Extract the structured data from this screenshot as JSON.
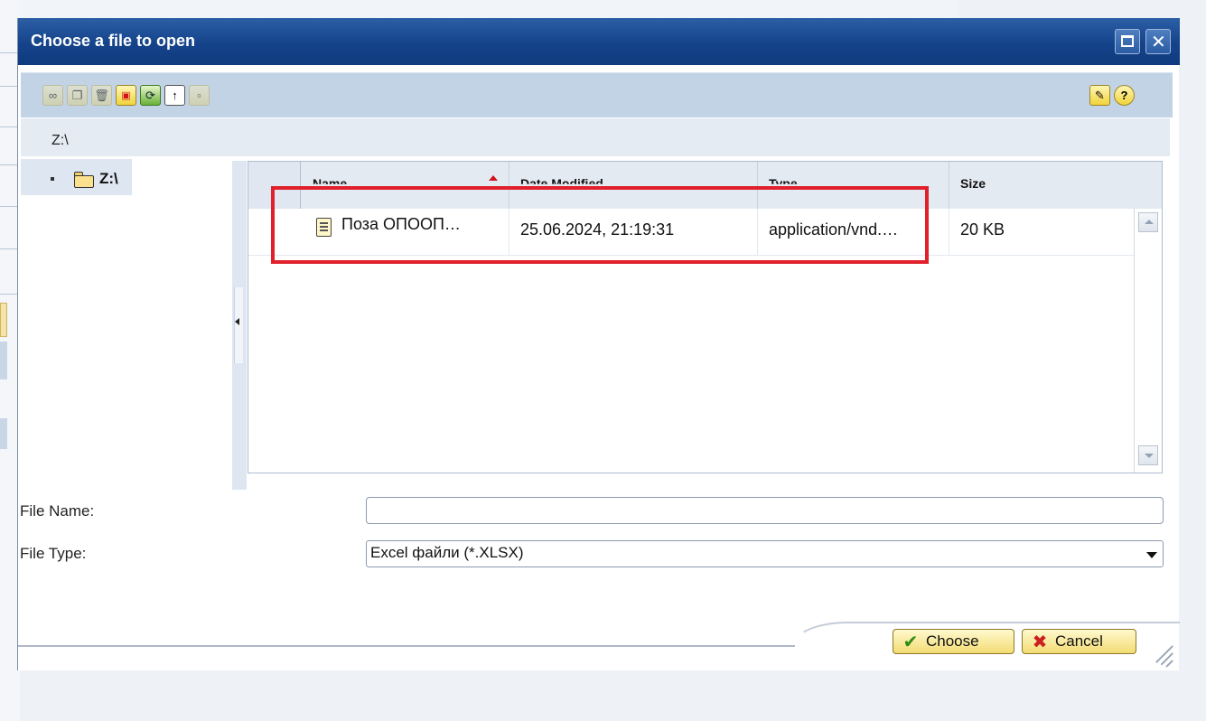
{
  "dialog": {
    "title": "Choose a file to open",
    "path": "Z:\\"
  },
  "toolbar": {
    "buttons": [
      {
        "icon": "link-icon",
        "enabled": false
      },
      {
        "icon": "copy-icon",
        "enabled": false
      },
      {
        "icon": "delete-icon",
        "enabled": false
      },
      {
        "icon": "new-folder-icon",
        "enabled": true
      },
      {
        "icon": "refresh-icon",
        "enabled": true
      },
      {
        "icon": "up-folder-icon",
        "enabled": true
      },
      {
        "icon": "view-icon",
        "enabled": false
      }
    ],
    "right_buttons": [
      {
        "icon": "pencil-icon"
      },
      {
        "icon": "help-icon"
      }
    ]
  },
  "tree": {
    "items": [
      {
        "label": "Z:\\",
        "icon": "folder-icon"
      }
    ]
  },
  "table": {
    "columns": [
      "Name",
      "Date Modified",
      "Type",
      "Size"
    ],
    "sort_column": "Name",
    "rows": [
      {
        "name": "Поза ОПООП…",
        "date_modified": "25.06.2024, 21:19:31",
        "type": "application/vnd.…",
        "size": "20 KB"
      }
    ]
  },
  "form": {
    "file_name_label": "File Name:",
    "file_name_value": "",
    "file_type_label": "File Type:",
    "file_type_value": "Excel файли (*.XLSX)"
  },
  "buttons": {
    "choose": "Choose",
    "cancel": "Cancel"
  },
  "colors": {
    "titlebar": "#15438a",
    "highlight": "#e0202a",
    "button": "#f3dc73"
  }
}
